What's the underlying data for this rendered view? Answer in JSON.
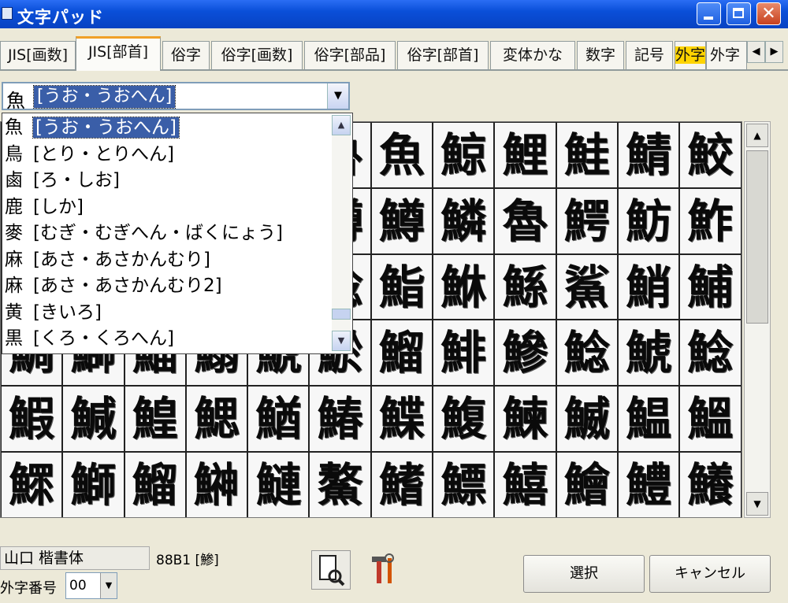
{
  "window": {
    "title": "文字パッド"
  },
  "tabs": [
    {
      "label": "JIS[画数]"
    },
    {
      "label": "JIS[部首]"
    },
    {
      "label": "俗字"
    },
    {
      "label": "俗字[画数]"
    },
    {
      "label": "俗字[部品]"
    },
    {
      "label": "俗字[部首]"
    },
    {
      "label": "変体かな"
    },
    {
      "label": "数字"
    },
    {
      "label": "記号"
    },
    {
      "label": "外字"
    },
    {
      "label": "外字"
    }
  ],
  "radical_combo": {
    "radical": "魚",
    "label": "[うお・うおへん]"
  },
  "dropdown_items": [
    {
      "radical": "魚",
      "label": "[うお・うおへん]"
    },
    {
      "radical": "鳥",
      "label": "[とり・とりへん]"
    },
    {
      "radical": "鹵",
      "label": "[ろ・しお]"
    },
    {
      "radical": "鹿",
      "label": "[しか]"
    },
    {
      "radical": "麥",
      "label": "[むぎ・むぎへん・ばくにょう]"
    },
    {
      "radical": "麻",
      "label": "[あさ・あさかんむり]"
    },
    {
      "radical": "麻",
      "label": "[あさ・あさかんむり2]"
    },
    {
      "radical": "黄",
      "label": "[きいろ]"
    },
    {
      "radical": "黒",
      "label": "[くろ・くろへん]"
    }
  ],
  "grid": [
    [
      "",
      "",
      "",
      "",
      "",
      "魯",
      "魚",
      "鯨",
      "鯉",
      "鮭",
      "鯖",
      "鮫"
    ],
    [
      "",
      "",
      "",
      "",
      "",
      "鱒",
      "鱒",
      "鱗",
      "魯",
      "鰐",
      "魴",
      "鮓"
    ],
    [
      "",
      "",
      "",
      "",
      "",
      "鯰",
      "鮨",
      "鮴",
      "鯀",
      "鯊",
      "鮹",
      "鯆"
    ],
    [
      "鯛",
      "鰤",
      "鯔",
      "鰯",
      "鯱",
      "鯲",
      "鰡",
      "鯡",
      "鰺",
      "鯰",
      "鯱",
      "鯰"
    ],
    [
      "鰕",
      "鰔",
      "鰉",
      "鰓",
      "鰌",
      "鰆",
      "鰈",
      "鰒",
      "鰊",
      "鰄",
      "鰛",
      "鰮"
    ],
    [
      "鰥",
      "鰤",
      "鰡",
      "鰰",
      "鰱",
      "鰲",
      "鰭",
      "鰾",
      "鱚",
      "鱠",
      "鱧",
      "鱶"
    ]
  ],
  "status": {
    "font_name": "山口 楷書体",
    "char_code": "88B1 [鯵]",
    "gaiji_label": "外字番号",
    "gaiji_number": "00"
  },
  "buttons": {
    "select": "選択",
    "cancel": "キャンセル"
  },
  "icons": {
    "preview": "preview-zoom-icon",
    "tools": "tools-icon"
  }
}
